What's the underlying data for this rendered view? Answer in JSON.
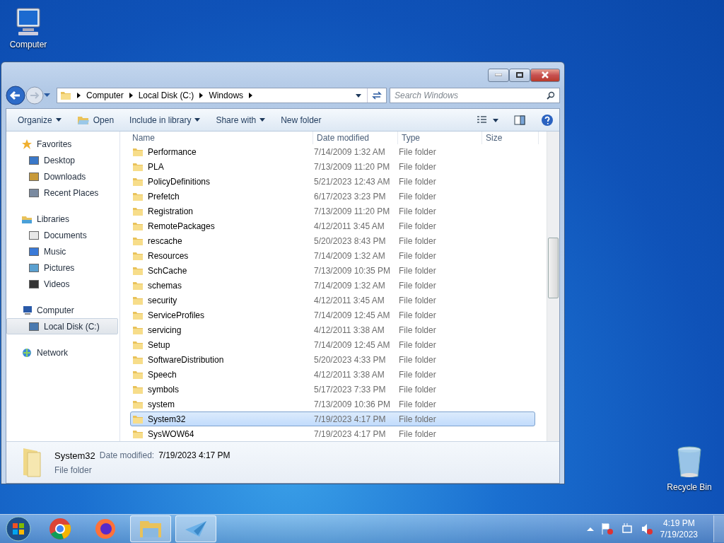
{
  "desktop_icons": [
    {
      "label": "Computer"
    },
    {
      "label": "Recycle Bin"
    }
  ],
  "address": {
    "crumbs": [
      "Computer",
      "Local Disk (C:)",
      "Windows"
    ],
    "search_placeholder": "Search Windows"
  },
  "toolbar": [
    {
      "label": "Organize",
      "kind": "menu"
    },
    {
      "label": "Open",
      "kind": "action"
    },
    {
      "label": "Include in library",
      "kind": "menu"
    },
    {
      "label": "Share with",
      "kind": "menu"
    },
    {
      "label": "New folder",
      "kind": "plain"
    }
  ],
  "nav": [
    {
      "label": "Favorites",
      "selected": false,
      "children": [
        {
          "label": "Desktop",
          "selected": false
        },
        {
          "label": "Downloads",
          "selected": false
        },
        {
          "label": "Recent Places",
          "selected": false
        }
      ]
    },
    {
      "label": "Libraries",
      "selected": false,
      "children": [
        {
          "label": "Documents",
          "selected": false
        },
        {
          "label": "Music",
          "selected": false
        },
        {
          "label": "Pictures",
          "selected": false
        },
        {
          "label": "Videos",
          "selected": false
        }
      ]
    },
    {
      "label": "Computer",
      "selected": false,
      "children": [
        {
          "label": "Local Disk (C:)",
          "selected": true
        }
      ]
    },
    {
      "label": "Network",
      "selected": false
    }
  ],
  "columns": [
    "Name",
    "Date modified",
    "Type",
    "Size"
  ],
  "rows": [
    {
      "name": "Performance",
      "date": "7/14/2009 1:32 AM",
      "type": "File folder",
      "selected": false
    },
    {
      "name": "PLA",
      "date": "7/13/2009 11:20 PM",
      "type": "File folder",
      "selected": false
    },
    {
      "name": "PolicyDefinitions",
      "date": "5/21/2023 12:43 AM",
      "type": "File folder",
      "selected": false
    },
    {
      "name": "Prefetch",
      "date": "6/17/2023 3:23 PM",
      "type": "File folder",
      "selected": false
    },
    {
      "name": "Registration",
      "date": "7/13/2009 11:20 PM",
      "type": "File folder",
      "selected": false
    },
    {
      "name": "RemotePackages",
      "date": "4/12/2011 3:45 AM",
      "type": "File folder",
      "selected": false
    },
    {
      "name": "rescache",
      "date": "5/20/2023 8:43 PM",
      "type": "File folder",
      "selected": false
    },
    {
      "name": "Resources",
      "date": "7/14/2009 1:32 AM",
      "type": "File folder",
      "selected": false
    },
    {
      "name": "SchCache",
      "date": "7/13/2009 10:35 PM",
      "type": "File folder",
      "selected": false
    },
    {
      "name": "schemas",
      "date": "7/14/2009 1:32 AM",
      "type": "File folder",
      "selected": false
    },
    {
      "name": "security",
      "date": "4/12/2011 3:45 AM",
      "type": "File folder",
      "selected": false
    },
    {
      "name": "ServiceProfiles",
      "date": "7/14/2009 12:45 AM",
      "type": "File folder",
      "selected": false
    },
    {
      "name": "servicing",
      "date": "4/12/2011 3:38 AM",
      "type": "File folder",
      "selected": false
    },
    {
      "name": "Setup",
      "date": "7/14/2009 12:45 AM",
      "type": "File folder",
      "selected": false
    },
    {
      "name": "SoftwareDistribution",
      "date": "5/20/2023 4:33 PM",
      "type": "File folder",
      "selected": false
    },
    {
      "name": "Speech",
      "date": "4/12/2011 3:38 AM",
      "type": "File folder",
      "selected": false
    },
    {
      "name": "symbols",
      "date": "5/17/2023 7:33 PM",
      "type": "File folder",
      "selected": false
    },
    {
      "name": "system",
      "date": "7/13/2009 10:36 PM",
      "type": "File folder",
      "selected": false
    },
    {
      "name": "System32",
      "date": "7/19/2023 4:17 PM",
      "type": "File folder",
      "selected": true
    },
    {
      "name": "SysWOW64",
      "date": "7/19/2023 4:17 PM",
      "type": "File folder",
      "selected": false
    }
  ],
  "details": {
    "name": "System32",
    "date_label": "Date modified:",
    "date": "7/19/2023 4:17 PM",
    "type": "File folder"
  },
  "taskbar": {
    "apps": [
      {
        "active": false
      },
      {
        "active": false
      },
      {
        "active": true
      },
      {
        "active": true
      }
    ],
    "time": "4:19 PM",
    "date": "7/19/2023"
  }
}
